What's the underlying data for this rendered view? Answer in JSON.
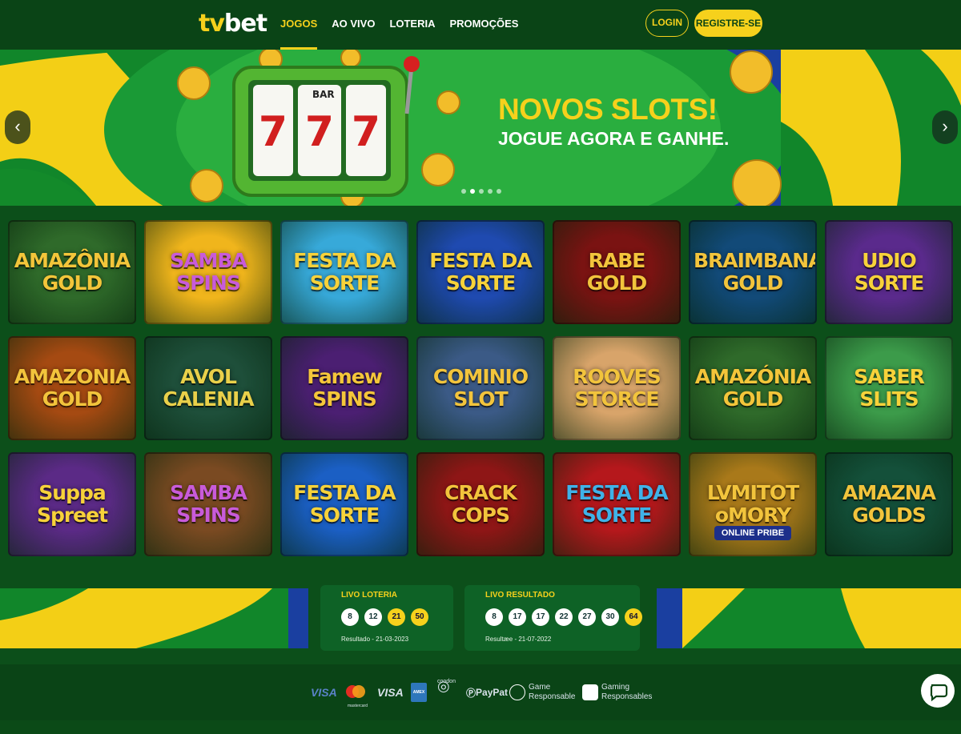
{
  "header": {
    "logo_tv": "tv",
    "logo_bet": "bet",
    "nav": [
      "JOGOS",
      "AO VIVO",
      "LOTERIA",
      "PROMOÇÕES"
    ],
    "login_label": "LOGIN",
    "register_label": "REGISTRE-SE"
  },
  "banner": {
    "title": "NOVOS SLOTS!",
    "subtitle": "JOGUE AGORA E GANHE.",
    "reel_bar": "BAR",
    "reel_seven": "7",
    "prev_arrow": "‹",
    "next_arrow": "›",
    "slides": 5,
    "active_slide": 2
  },
  "games": [
    {
      "title": "AMAZÔNIA GOLD",
      "bg": "#2f6a2a",
      "color": "#f3c53a"
    },
    {
      "title": "SAMBA SPINS",
      "bg": "#f0b51c",
      "color": "#c85bd9"
    },
    {
      "title": "FESTA DA SORTE",
      "bg": "#37a9d9",
      "color": "#f7d23a"
    },
    {
      "title": "FESTA DA SORTE",
      "bg": "#1f4ab0",
      "color": "#f7d23a"
    },
    {
      "title": "RABE GOLD",
      "bg": "#7a1312",
      "color": "#f2c43c"
    },
    {
      "title": "BRAIMBANA GOLD",
      "bg": "#124a78",
      "color": "#f2c43c"
    },
    {
      "title": "UDIO SORTE",
      "bg": "#5a2a8c",
      "color": "#f7d23a"
    },
    {
      "title": "AMAZONIA GOLD",
      "bg": "#a54a12",
      "color": "#f2c43c"
    },
    {
      "title": "AVOL CALENIA",
      "bg": "#1e4f3a",
      "color": "#e9d04a"
    },
    {
      "title": "Famew SPINS",
      "bg": "#4b1f72",
      "color": "#f4c63a"
    },
    {
      "title": "COMINIO SLOT",
      "bg": "#3b5a86",
      "color": "#f2c43c"
    },
    {
      "title": "ROOVES STORCE",
      "bg": "#d8a46a",
      "color": "#f2c43c"
    },
    {
      "title": "AMAZÓNIA GOLD",
      "bg": "#2f6a2a",
      "color": "#f3c53a"
    },
    {
      "title": "SABER SLITS",
      "bg": "#3c9b4a",
      "color": "#f7d23a"
    },
    {
      "title": "Suppa Spreet",
      "bg": "#5b2a86",
      "color": "#f7d23a"
    },
    {
      "title": "SAMBA SPINS",
      "bg": "#7a4a22",
      "color": "#c85bd9"
    },
    {
      "title": "FESTA DA SORTE",
      "bg": "#1b5fc4",
      "color": "#f7d23a"
    },
    {
      "title": "CRACK COPS",
      "bg": "#8e1616",
      "color": "#f2c43c"
    },
    {
      "title": "FESTA DA SORTE",
      "bg": "#b5181c",
      "color": "#3fb2e8"
    },
    {
      "title": "LVMITOT oMORY",
      "bg": "#a9791a",
      "color": "#f2c43c",
      "sub": "ONLINE PRIBE"
    },
    {
      "title": "AMAZNA GOLDS",
      "bg": "#14503a",
      "color": "#f2c43c"
    }
  ],
  "lottery": [
    {
      "title": "LIVO LOTERIA",
      "numbers": [
        "8",
        "12",
        "21",
        "50"
      ],
      "gold": [
        false,
        false,
        true,
        true
      ],
      "date": "Resultado - 21-03-2023"
    },
    {
      "title": "LIVO RESULTADO",
      "numbers": [
        "8",
        "17",
        "17",
        "22",
        "27",
        "30",
        "64"
      ],
      "gold": [
        false,
        false,
        false,
        false,
        false,
        false,
        true
      ],
      "date": "Resultæe - 21-07-2022"
    }
  ],
  "footer": {
    "payments": [
      "VISA",
      "mastercard",
      "VISA",
      "AMEX",
      "coodon",
      "PayPat"
    ],
    "responsible_1": "Game Responsable",
    "responsible_2": "Gaming Responsables"
  },
  "colors": {
    "brand_yellow": "#f6d11c",
    "brand_green": "#0a4416",
    "brazil_blue": "#1a3fa0"
  }
}
